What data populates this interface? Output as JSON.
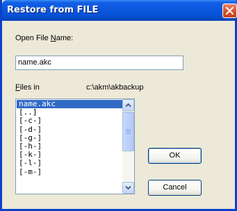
{
  "window": {
    "title": "Restore from FILE"
  },
  "open_file_name": {
    "label_pre": "Open File ",
    "label_key": "N",
    "label_post": "ame:",
    "value": "name.akc"
  },
  "files_in": {
    "label_key": "F",
    "label_post": "iles in",
    "path": "c:\\akm\\akbackup"
  },
  "file_list": {
    "items": [
      {
        "label": "name.akc",
        "selected": true
      },
      {
        "label": "[..]",
        "selected": false
      },
      {
        "label": "[-c-]",
        "selected": false
      },
      {
        "label": "[-d-]",
        "selected": false
      },
      {
        "label": "[-g-]",
        "selected": false
      },
      {
        "label": "[-h-]",
        "selected": false
      },
      {
        "label": "[-k-]",
        "selected": false
      },
      {
        "label": "[-l-]",
        "selected": false
      },
      {
        "label": "[-m-]",
        "selected": false
      }
    ]
  },
  "buttons": {
    "ok": "OK",
    "cancel": "Cancel"
  },
  "icons": {
    "close": "close-icon",
    "scroll_up": "arrow-up-icon",
    "scroll_down": "arrow-down-icon"
  }
}
